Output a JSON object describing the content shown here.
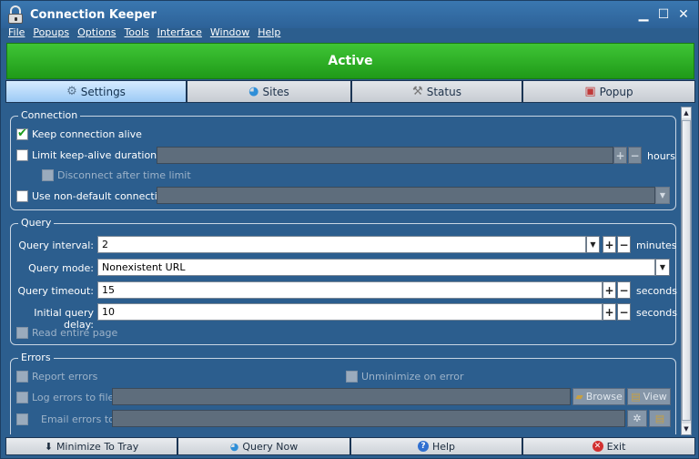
{
  "window": {
    "title": "Connection Keeper"
  },
  "menu": [
    "File",
    "Popups",
    "Options",
    "Tools",
    "Interface",
    "Window",
    "Help"
  ],
  "banner": {
    "status": "Active",
    "color": "#2fb327"
  },
  "tabs": [
    {
      "label": "Settings",
      "icon": "gear-icon",
      "selected": true
    },
    {
      "label": "Sites",
      "icon": "globe-icon",
      "selected": false
    },
    {
      "label": "Status",
      "icon": "tool-icon",
      "selected": false
    },
    {
      "label": "Popup",
      "icon": "popup-window-icon",
      "selected": false
    }
  ],
  "connection": {
    "legend": "Connection",
    "keep_alive": {
      "label": "Keep connection alive",
      "checked": true
    },
    "limit_duration": {
      "label": "Limit keep-alive duration to:",
      "checked": false,
      "value": "",
      "unit": "hours"
    },
    "disconnect_after_limit": {
      "label": "Disconnect after time limit",
      "checked": false,
      "disabled": true
    },
    "non_default_connection": {
      "label": "Use non-default connection:",
      "checked": false,
      "value": ""
    }
  },
  "query": {
    "legend": "Query",
    "interval": {
      "label": "Query interval:",
      "value": "2",
      "unit": "minutes"
    },
    "mode": {
      "label": "Query mode:",
      "value": "Nonexistent URL"
    },
    "timeout": {
      "label": "Query timeout:",
      "value": "15",
      "unit": "seconds"
    },
    "initial_delay": {
      "label": "Initial query delay:",
      "value": "10",
      "unit": "seconds"
    },
    "read_entire_page": {
      "label": "Read entire page",
      "checked": false,
      "disabled": true
    }
  },
  "errors": {
    "legend": "Errors",
    "report_errors": {
      "label": "Report errors",
      "checked": false,
      "disabled": true
    },
    "unminimize_on_error": {
      "label": "Unminimize on error",
      "checked": false,
      "disabled": true
    },
    "log_errors": {
      "label": "Log errors to file:",
      "checked": false,
      "value": ""
    },
    "browse_label": "Browse",
    "view_label": "View",
    "email_errors": {
      "label": "Email errors to:",
      "checked": false,
      "value": ""
    }
  },
  "bottom_buttons": [
    {
      "label": "Minimize To Tray",
      "icon": "download-arrow-icon"
    },
    {
      "label": "Query Now",
      "icon": "globe-icon"
    },
    {
      "label": "Help",
      "icon": "help-icon"
    },
    {
      "label": "Exit",
      "icon": "exit-icon"
    }
  ]
}
